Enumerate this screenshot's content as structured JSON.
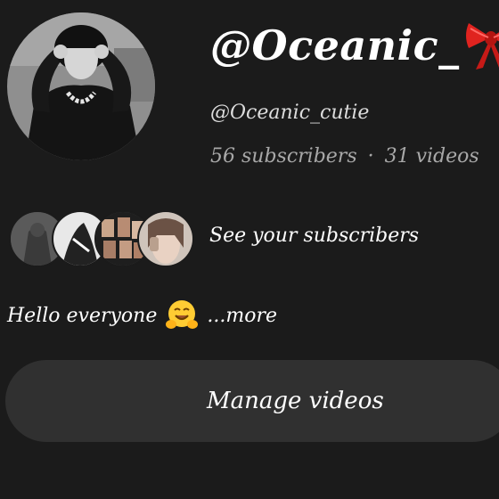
{
  "profile": {
    "channel_name": "@Oceanic_",
    "handle": "@Oceanic_cutie",
    "subscribers": "56 subscribers",
    "separator": "·",
    "videos": "31 videos",
    "decoration_icon": "ribbon-bow-icon"
  },
  "subscribers_preview": {
    "label": "See your subscribers",
    "avatar_count": 4
  },
  "bio": {
    "text": "Hello everyone",
    "emoji_icon": "hugging-face-icon",
    "more_label": "...more"
  },
  "actions": {
    "manage_videos_label": "Manage videos"
  },
  "colors": {
    "background": "#1b1b1b",
    "button": "#303030",
    "muted_text": "#a8a8a8",
    "bow": "#e0231f"
  }
}
